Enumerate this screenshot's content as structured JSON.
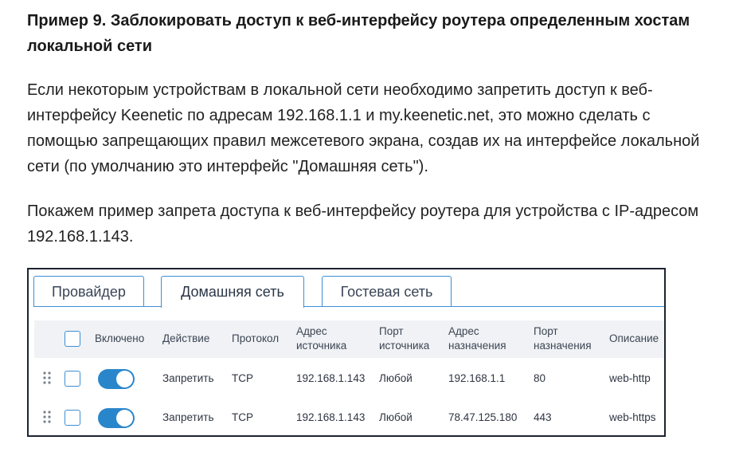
{
  "article": {
    "heading": "Пример 9. Заблокировать доступ к веб-интерфейсу роутера определенным хостам локальной сети",
    "paragraph1": "Если некоторым устройствам в локальной сети необходимо запретить доступ к веб-интерфейсу Keenetic по адресам 192.168.1.1 и my.keenetic.net, это можно сделать с помощью запрещающих правил межсетевого экрана, создав их на интерфейсе локальной сети (по умолчанию это интерфейс \"Домашняя сеть\").",
    "paragraph2": "Покажем пример запрета доступа к веб-интерфейсу роутера для устройства с IP-адресом 192.168.1.143."
  },
  "tabs": [
    {
      "label": "Провайдер",
      "active": false
    },
    {
      "label": "Домашняя сеть",
      "active": true
    },
    {
      "label": "Гостевая сеть",
      "active": false
    }
  ],
  "table": {
    "headers": {
      "enabled": "Включено",
      "action": "Действие",
      "protocol": "Протокол",
      "src_addr_1": "Адрес",
      "src_addr_2": "источника",
      "src_port_1": "Порт",
      "src_port_2": "источника",
      "dst_addr_1": "Адрес",
      "dst_addr_2": "назначения",
      "dst_port_1": "Порт",
      "dst_port_2": "назначения",
      "description": "Описание"
    },
    "rows": [
      {
        "enabled": true,
        "action": "Запретить",
        "protocol": "TCP",
        "src_addr": "192.168.1.143",
        "src_port": "Любой",
        "dst_addr": "192.168.1.1",
        "dst_port": "80",
        "description": "web-http"
      },
      {
        "enabled": true,
        "action": "Запретить",
        "protocol": "TCP",
        "src_addr": "192.168.1.143",
        "src_port": "Любой",
        "dst_addr": "78.47.125.180",
        "dst_port": "443",
        "description": "web-https"
      }
    ]
  },
  "colors": {
    "accent": "#3b8fd4",
    "toggle_on": "#2a86cb",
    "header_bg": "#f0f2f5",
    "panel_border": "#1d2330"
  },
  "icons": {
    "grip": "drag-handle-icon"
  }
}
